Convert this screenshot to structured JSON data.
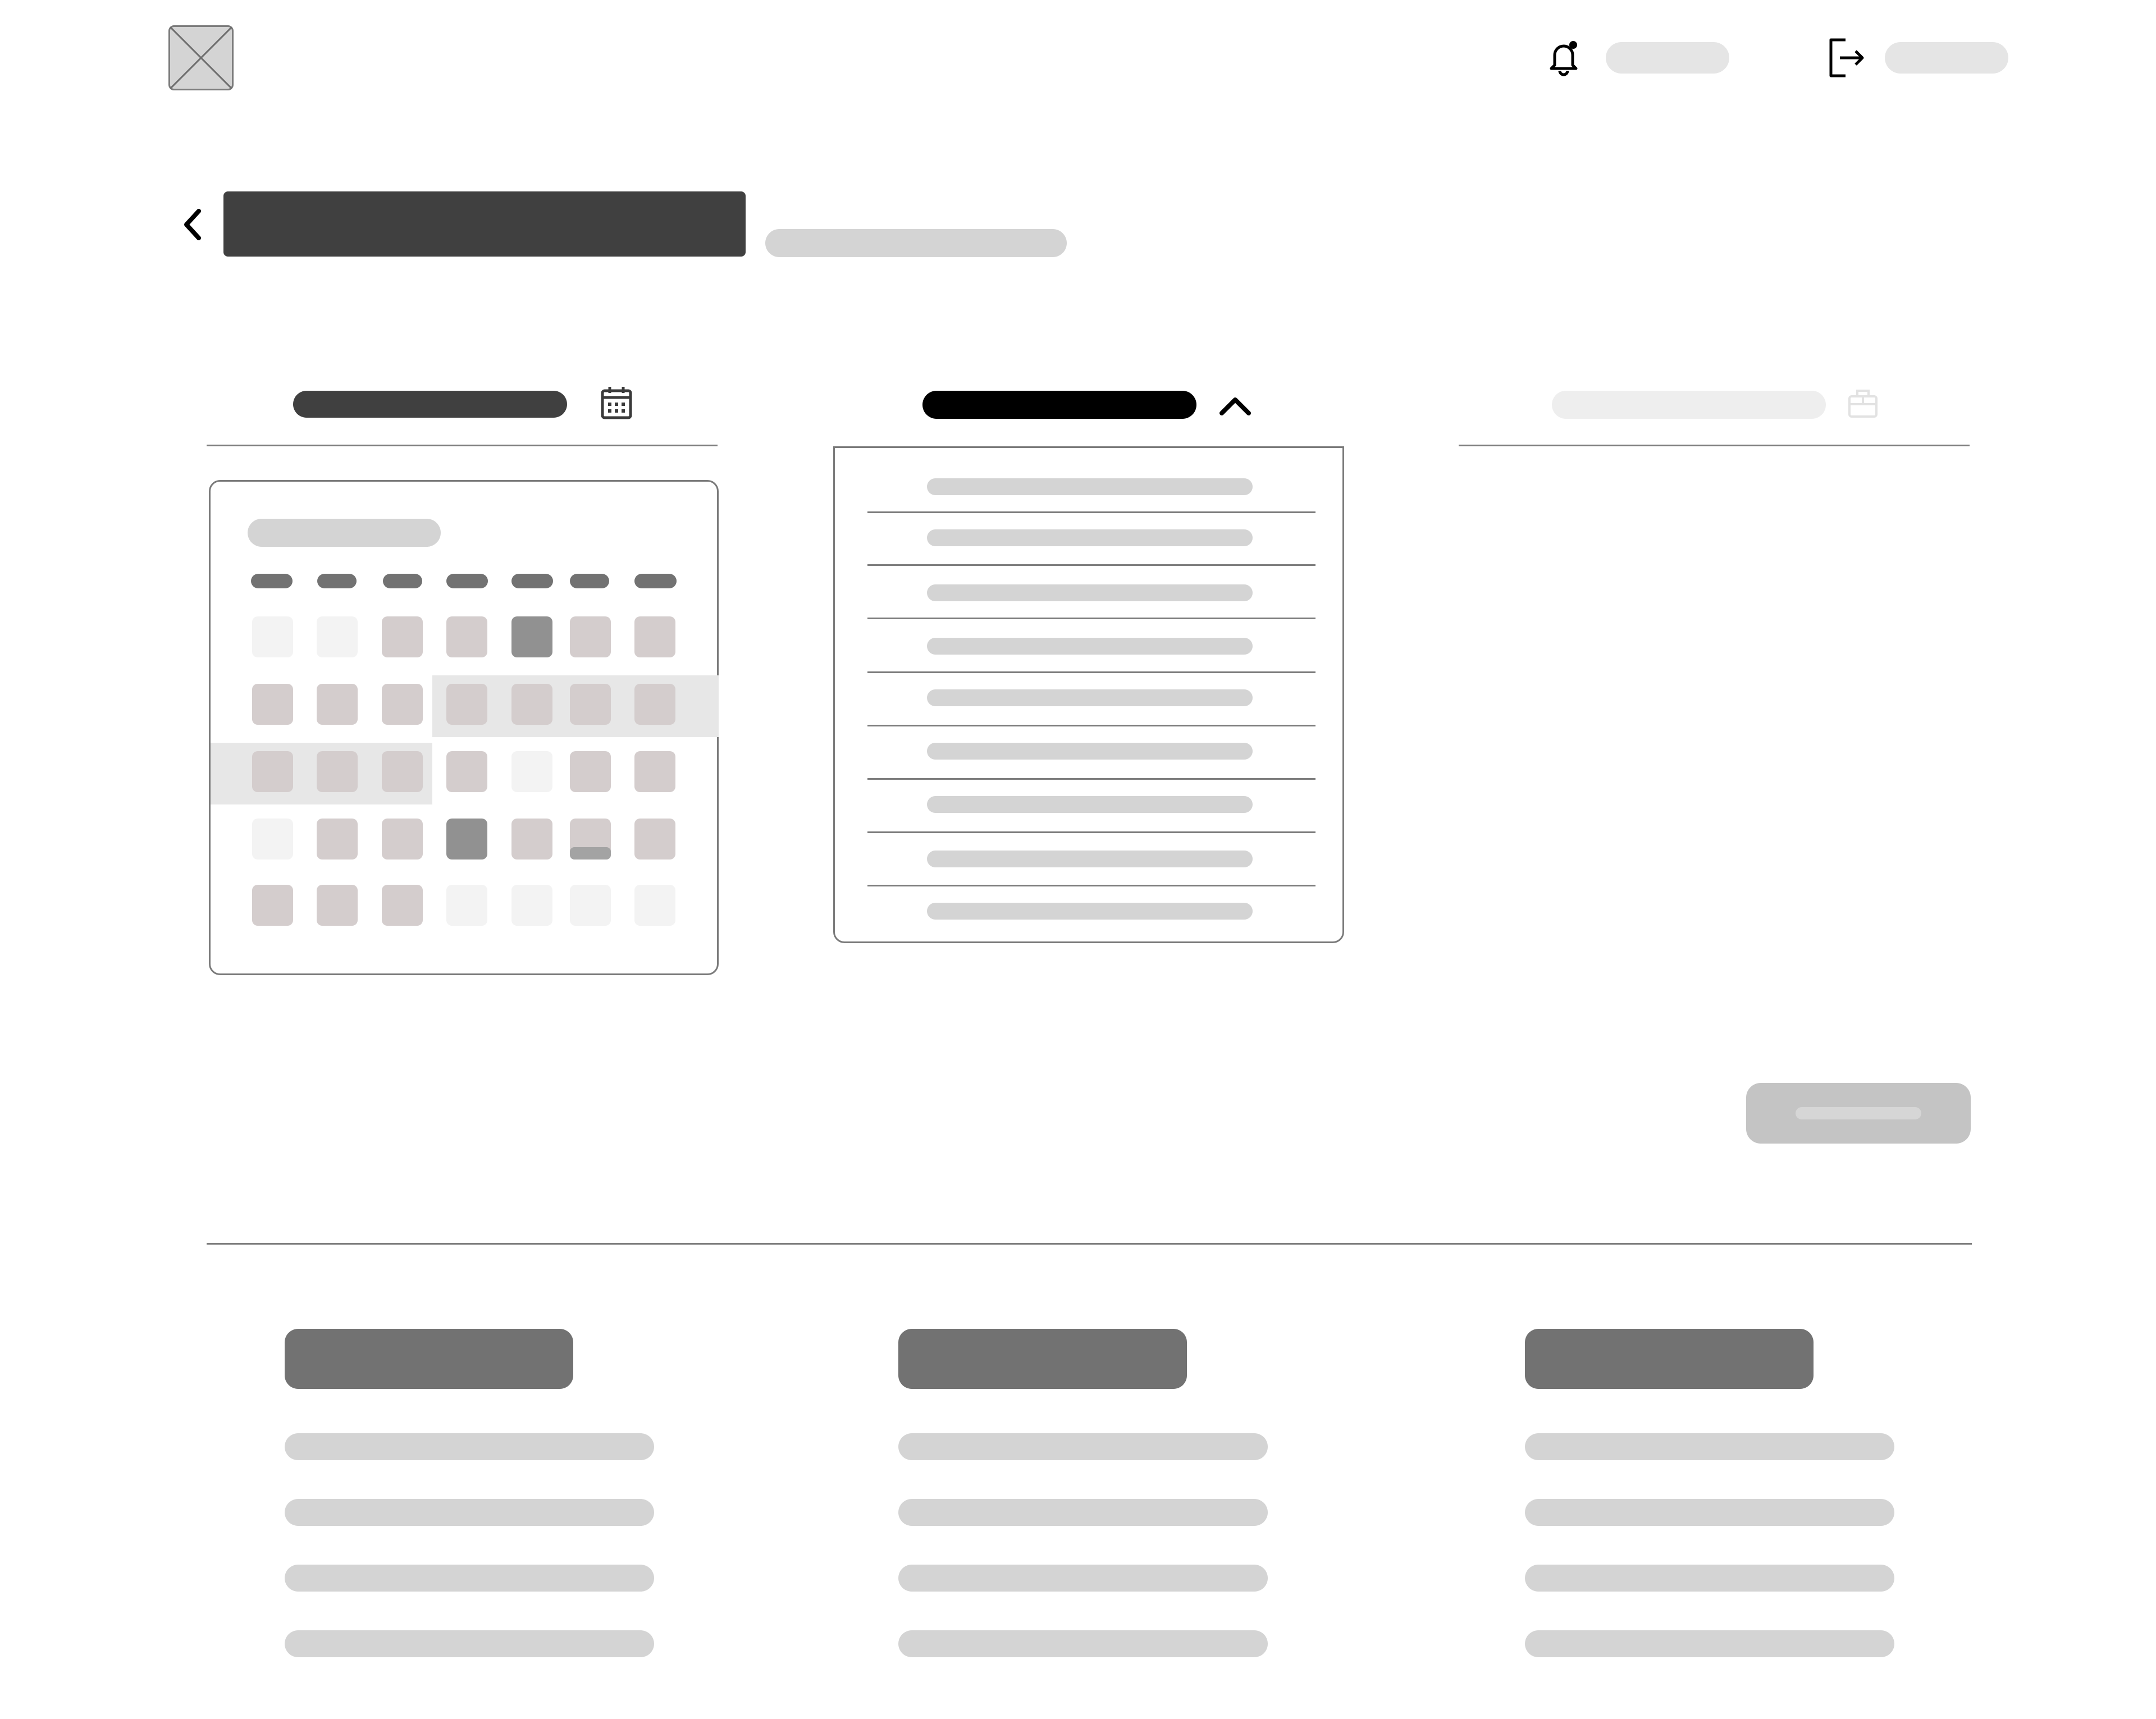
{
  "header": {
    "logo_icon": "image-placeholder-icon",
    "notifications_icon": "bell-icon",
    "logout_icon": "logout-icon"
  },
  "page": {
    "back_icon": "chevron-left-icon"
  },
  "columns": {
    "calendar_icon": "calendar-icon",
    "dropdown_icon": "chevron-up-icon",
    "disabled_icon": "bag-icon"
  },
  "colors": {
    "title_bar": "#404040",
    "placeholder_light": "#d4d4d4",
    "placeholder_faint": "#e5e5e5",
    "calendar_day": "#d4cdcd",
    "calendar_day_selected": "#919191",
    "calendar_day_outside": "#f3f3f3",
    "button_disabled": "#c4c4c4",
    "section_title": "#727272"
  }
}
